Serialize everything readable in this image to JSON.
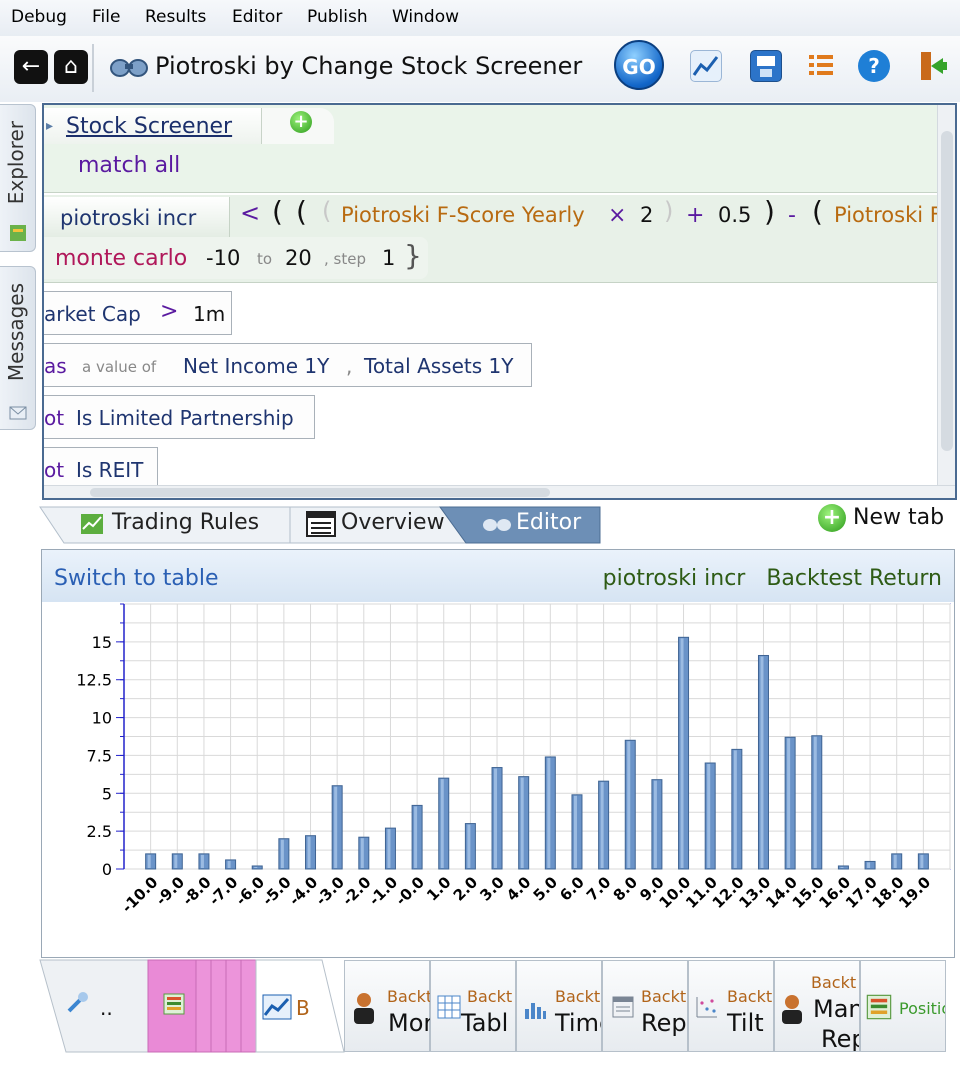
{
  "menu": [
    "Debug",
    "File",
    "Results",
    "Editor",
    "Publish",
    "Window"
  ],
  "toolbar": {
    "title": "Piotroski by Change Stock Screener",
    "go_label": "GO"
  },
  "sidebar": {
    "explorer": "Explorer",
    "messages": "Messages"
  },
  "editor": {
    "screener_tab": "Stock Screener",
    "match": "match all",
    "rule_name": "piotroski incr",
    "formula": {
      "lt": "<",
      "paren1": "(",
      "paren2": "(",
      "paren3": "(",
      "f1": "Piotroski F-Score Yearly",
      "times": "×",
      "two": "2",
      "close1": ")",
      "plus": "+",
      "half": "0.5",
      "close2": ")",
      "minus": "-",
      "paren4": "(",
      "f2": "Piotroski F"
    },
    "monte": {
      "label": "monte carlo",
      "from": "-10",
      "to_label": "to",
      "to": "20",
      "step_label": ", step",
      "step": "1",
      "brace": "}"
    },
    "cond1": {
      "field": "arket Cap",
      "op": ">",
      "value": "1m"
    },
    "cond2": {
      "prefix": "as",
      "hint": "a value of",
      "a": "Net Income 1Y",
      "sep": ",",
      "b": "Total Assets 1Y"
    },
    "cond3": {
      "prefix": "ot",
      "field": "Is Limited Partnership"
    },
    "cond4": {
      "prefix": "ot",
      "field": "Is REIT"
    }
  },
  "midtabs": {
    "trading_rules": "Trading Rules",
    "overview": "Overview",
    "editor": "Editor",
    "new_tab": "New tab"
  },
  "chart_panel": {
    "switch": "Switch to table",
    "title_rule": "piotroski incr",
    "title_metric": "Backtest Return"
  },
  "chart_data": {
    "type": "bar",
    "title": "piotroski incr  Backtest Return",
    "categories": [
      "-10.0",
      "-9.0",
      "-8.0",
      "-7.0",
      "-6.0",
      "-5.0",
      "-4.0",
      "-3.0",
      "-2.0",
      "-1.0",
      "-0.0",
      "1.0",
      "2.0",
      "3.0",
      "4.0",
      "5.0",
      "6.0",
      "7.0",
      "8.0",
      "9.0",
      "10.0",
      "11.0",
      "12.0",
      "13.0",
      "14.0",
      "15.0",
      "16.0",
      "17.0",
      "18.0",
      "19.0"
    ],
    "values": [
      1.0,
      1.0,
      1.0,
      0.6,
      0.2,
      2.0,
      2.2,
      5.5,
      2.1,
      2.7,
      4.2,
      6.0,
      3.0,
      6.7,
      6.1,
      7.4,
      4.9,
      5.8,
      8.5,
      5.9,
      15.3,
      7.0,
      7.9,
      14.1,
      8.7,
      8.8,
      0.2,
      0.5,
      1.0,
      1.0
    ],
    "yticks": [
      "0",
      "2.5",
      "5",
      "7.5",
      "10",
      "12.5",
      "15"
    ],
    "ylim": [
      0,
      17.5
    ],
    "grid": true,
    "bar_color": "#6a93c8"
  },
  "bottom_tabs": [
    {
      "small": "",
      "big": ".."
    },
    {
      "small": "",
      "big": ""
    },
    {
      "small": "",
      "big": "B"
    },
    {
      "small": "Backtest",
      "big": "Monte"
    },
    {
      "small": "Backt",
      "big": "Tabl"
    },
    {
      "small": "Backt",
      "big": "Time"
    },
    {
      "small": "Backt",
      "big": "Rep"
    },
    {
      "small": "Backt",
      "big": "Tilt"
    },
    {
      "small": "Backt",
      "big": "Man",
      "big2": "Rep"
    },
    {
      "small": "Position",
      "big": ""
    }
  ],
  "colors": {
    "keyword": "#5a1aa0",
    "field": "#b86a10",
    "monte": "#b0185a",
    "accent": "#2a5fb4"
  }
}
